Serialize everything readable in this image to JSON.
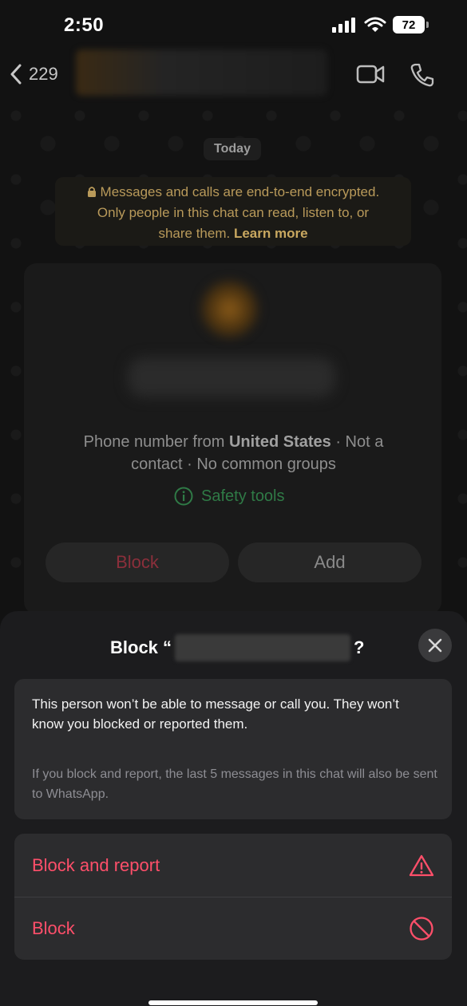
{
  "status": {
    "time": "2:50",
    "battery": "72"
  },
  "header": {
    "back_count": "229"
  },
  "chat": {
    "date": "Today",
    "encryption_line1": "Messages and calls are end-to-end encrypted.",
    "encryption_line2": "Only people in this chat can read, listen to, or",
    "encryption_line3": "share them.",
    "learn_more": "Learn more"
  },
  "card": {
    "info_prefix": "Phone number from",
    "country": "United States",
    "info_suffix_1": "· Not a",
    "info_line2": "contact · No common groups",
    "safety_tools": "Safety tools",
    "block_label": "Block",
    "add_label": "Add"
  },
  "sheet": {
    "title_prefix": "Block “",
    "title_suffix": "?",
    "message": "This person won’t be able to message or call you. They won’t know you blocked or reported them.",
    "note": "If you block and report, the last 5 messages in this chat will also be sent to WhatsApp.",
    "action_block_report": "Block and report",
    "action_block": "Block"
  },
  "colors": {
    "destructive": "#ff4f6a",
    "accent_green": "#2f7a46"
  }
}
